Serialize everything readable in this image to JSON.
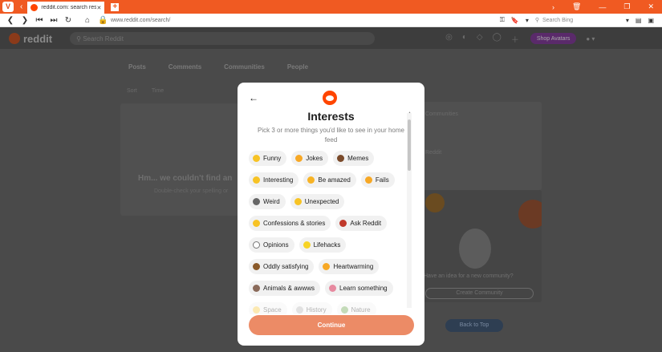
{
  "browser": {
    "tab_title": "reddit.com: search results -",
    "url": "www.reddit.com/search/",
    "search_placeholder": "Search Bing"
  },
  "reddit": {
    "brand": "reddit",
    "search_placeholder": "Search Reddit",
    "signup": "Shop Avatars",
    "tabs": [
      "Posts",
      "Comments",
      "Communities",
      "People"
    ],
    "filters": [
      "Sort",
      "Time"
    ],
    "no_results": "Hm... we couldn't find an",
    "no_results_sub": "Double-check your spelling or",
    "right_card_labels": [
      "Communities",
      "Reddit"
    ],
    "create_caption": "Have an idea for a new community?",
    "create_button": "Create Community",
    "back_to_top": "Back to Top"
  },
  "modal": {
    "title": "Interests",
    "subtitle": "Pick 3 or more things you'd like to see in your home feed",
    "continue_label": "Continue",
    "rows": [
      [
        {
          "label": "Funny",
          "emoji_color": "#f7c325"
        },
        {
          "label": "Jokes",
          "emoji_color": "#f7a825"
        },
        {
          "label": "Memes",
          "emoji_color": "#7a4a2a"
        }
      ],
      [
        {
          "label": "Interesting",
          "emoji_color": "#f7c325"
        },
        {
          "label": "Be amazed",
          "emoji_color": "#f7b325"
        },
        {
          "label": "Fails",
          "emoji_color": "#f7a825"
        }
      ],
      [
        {
          "label": "Weird",
          "emoji_color": "#666666"
        },
        {
          "label": "Unexpected",
          "emoji_color": "#f7c325"
        }
      ],
      [
        {
          "label": "Confessions & stories",
          "emoji_color": "#f7c325"
        },
        {
          "label": "Ask Reddit",
          "emoji_color": "#c0392b"
        }
      ],
      [
        {
          "label": "Opinions",
          "emoji_color": "#ffffff"
        },
        {
          "label": "Lifehacks",
          "emoji_color": "#f7d325"
        }
      ],
      [
        {
          "label": "Oddly satisfying",
          "emoji_color": "#8a5a2a"
        },
        {
          "label": "Heartwarming",
          "emoji_color": "#f7a825"
        }
      ],
      [
        {
          "label": "Animals & awwws",
          "emoji_color": "#8a6a5a"
        },
        {
          "label": "Learn something",
          "emoji_color": "#e78aa0"
        }
      ],
      [
        {
          "label": "Space",
          "emoji_color": "#f7c325"
        },
        {
          "label": "History",
          "emoji_color": "#aaaaaa"
        },
        {
          "label": "Nature",
          "emoji_color": "#5a9a3a"
        }
      ]
    ]
  }
}
